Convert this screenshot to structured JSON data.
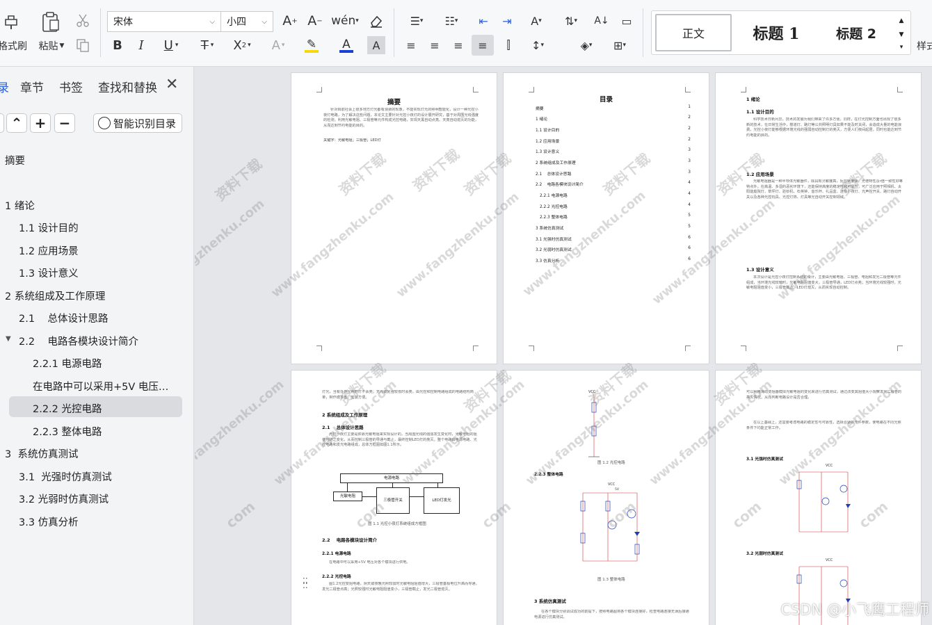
{
  "ribbon": {
    "format_painter": "格式刷",
    "paste": "粘贴",
    "font_name": "宋体",
    "font_size": "小四",
    "styles": {
      "normal": "正文",
      "heading1": "标题 1",
      "heading2": "标题 2",
      "more": "样式"
    }
  },
  "nav": {
    "tabs": [
      "录",
      "章节",
      "书签",
      "查找和替换"
    ],
    "smart_toc_button": "智能识别目录",
    "items": [
      {
        "label": "摘要"
      },
      {
        "label": "1 绪论"
      },
      {
        "label": "1.1 设计目的"
      },
      {
        "label": "1.2 应用场景"
      },
      {
        "label": "1.3 设计意义"
      },
      {
        "label": "2 系统组成及工作原理"
      },
      {
        "label": "2.1    总体设计思路"
      },
      {
        "label": "2.2    电路各模块设计简介"
      },
      {
        "label": "2.2.1 电源电路"
      },
      {
        "label": "在电路中可以采用+5V 电压…"
      },
      {
        "label": "2.2.2 光控电路"
      },
      {
        "label": "2.2.3 整体电路"
      },
      {
        "label": "3  系统仿真测试"
      },
      {
        "label": "3.1  光强时仿真测试"
      },
      {
        "label": "3.2 光弱时仿真测试"
      },
      {
        "label": "3.3 仿真分析"
      }
    ]
  },
  "pages": {
    "p1": {
      "title": "摘要",
      "body": "针对目前社会上很多地方灯光都有浪费的现象，不能实现灯光的照明智能化，设计一种光控小夜灯电路，为了解决这些问题，本论文主要针对光控小夜灯的设计展开研究，基于对周围光线强度的检测，利用光敏电阻、三极管等元件构成光控电路，实现天黑自动点亮、天亮自动熄灭的功能，从而达到节约电能的目的。",
      "keywords": "关键字：光敏电阻；三极管；LED灯"
    },
    "p2": {
      "title": "目录",
      "lines": [
        {
          "t": "摘要",
          "p": "1"
        },
        {
          "t": "1 绪论",
          "p": "2"
        },
        {
          "t": "1.1 设计目的",
          "p": "2"
        },
        {
          "t": "1.2 应用场景",
          "p": "2"
        },
        {
          "t": "1.3 设计意义",
          "p": "3"
        },
        {
          "t": "2 系统组成及工作原理",
          "p": "3"
        },
        {
          "t": "2.1    总体设计思路",
          "p": "3"
        },
        {
          "t": "2.2    电路各模块设计简介",
          "p": "4"
        },
        {
          "t": "2.2.1 电源电路",
          "p": "4"
        },
        {
          "t": "2.2.2 光控电路",
          "p": "4"
        },
        {
          "t": "2.2.3 整体电路",
          "p": "5"
        },
        {
          "t": "3 系统仿真测试",
          "p": "5"
        },
        {
          "t": "3.1 光强时仿真测试",
          "p": "6"
        },
        {
          "t": "3.2 光弱时仿真测试",
          "p": "6"
        },
        {
          "t": "3.3 仿真分析",
          "p": "6"
        }
      ]
    },
    "p3": {
      "h1": "1 绪论",
      "h11": "1.1 设计目的",
      "t11": "科学技术日新月异，技术的发展为我们带来了许多方便。同样，在灯光控制方面也出现了很多新的技术，在日常生活中，楼道灯、路灯等公共照明灯具如果不能及时关闭，会造成大量的电能浪费。光控小夜灯能够根据环境光线的强弱自动控制灯的亮灭，方便人们夜间起居，同时也能达到节约电能的目的。",
      "h12": "1.2 应用场景",
      "t12": "光敏电阻器是一种半导体光敏器件，除具有灵敏度高，反应速度快，光谱特性及r值一致性好等特点外，在高温、多湿的恶劣环境下，还能保持高度的稳定性和可靠性，可广泛应用于照相机、太阳能庭院灯、草坪灯、验钞机、石英钟、音乐杯、礼品盒、迷你小夜灯、光声控开关、路灯自动开关以及各种光控玩具、光控灯饰、灯具等光自动开关控制领域。",
      "h13": "1.3 设计意义",
      "t13": "本次设计是光控小夜灯控制系统的设计，主要由光敏电阻、三极管、电阻和发光二极管等元件组成，当环境光线较暗时，光敏电阻阻值变大，三极管导通，LED灯点亮；当环境光线较强时，光敏电阻阻值变小，三极管截止，LED灯熄灭，从而实现自动控制。"
    },
    "p4": {
      "t0": "灯光，当有外界光照时灯不会亮；无光或光强较低时会亮，由光控和控制电路组成的电路结构简单，制作成本低，安装方便。",
      "h2": "2 系统组成及工作原理",
      "h21": "2.1    总体设计思路",
      "t21": "光控小夜灯主要是依靠光敏电阻来实现设计的，当周围光线的强弱发生变化时，光敏电阻的阻值也随之变化，从而控制三极管的导通与截止，最终控制LED灯的亮灭。整个电路由电源电路、光控电路和发光电路组成，总体方框图如图1.1所示。",
      "block_top": "电源电路",
      "block_a": "光敏电阻",
      "block_b": "三极管开关",
      "block_c": "LED灯发光",
      "fig11": "图 1.1 光控小夜灯系统组成方框图",
      "h22": "2.2    电路各模块设计简介",
      "h221": "2.2.1 电源电路",
      "t221": "在电路中可以采用+5V 电压对各个模块进行供电。",
      "h222": "2.2.2 光控电路",
      "t222": "图1.2光控变阻电路，阴天或夜晚光照较弱时光敏电阻阻值增大，三极管基极电位升高而导通，发光二极管点亮；光照较强时光敏电阻阻值变小，三极管截止，发光二极管熄灭。"
    },
    "p5": {
      "vcc": "VCC",
      "vcc_v": "5V",
      "fig12": "图 1.2 光控电路",
      "h223": "2.2.3 整体电路",
      "fig13": "图 1.3 整体电路",
      "h3": "3 系统仿真测试",
      "t3": "在各个模块分别调试成功的前提下，按照电路图将各个模块连接好，检查电路连接无误后接通电源进行仿真测试。"
    },
    "p6": {
      "t0": "可以利用滑动变阻器模拟光敏电阻的变化来进行仿真测试，通过改变其阻值大小观察发光二极管的亮灭情况，从而判断电路设计是否合理。",
      "t1": "在以上基础上，还需要考虑电路的稳定性与可靠性，选择合适的元件参数，使电路在不同光照条件下均能正常工作。",
      "h31": "3.1 光强时仿真测试",
      "h32": "3.2 光弱时仿真测试"
    },
    "watermark_cn": "资料下载",
    "watermark_url": "www.fangzhenku.com",
    "watermark_com": "com"
  },
  "csdn_watermark": "CSDN @小飞鹰工程师",
  "colors": {
    "accent": "#2b5fd9",
    "highlight": "#f5d90a",
    "font_red": "#1a3fd6",
    "selected": "#d9dbde"
  }
}
